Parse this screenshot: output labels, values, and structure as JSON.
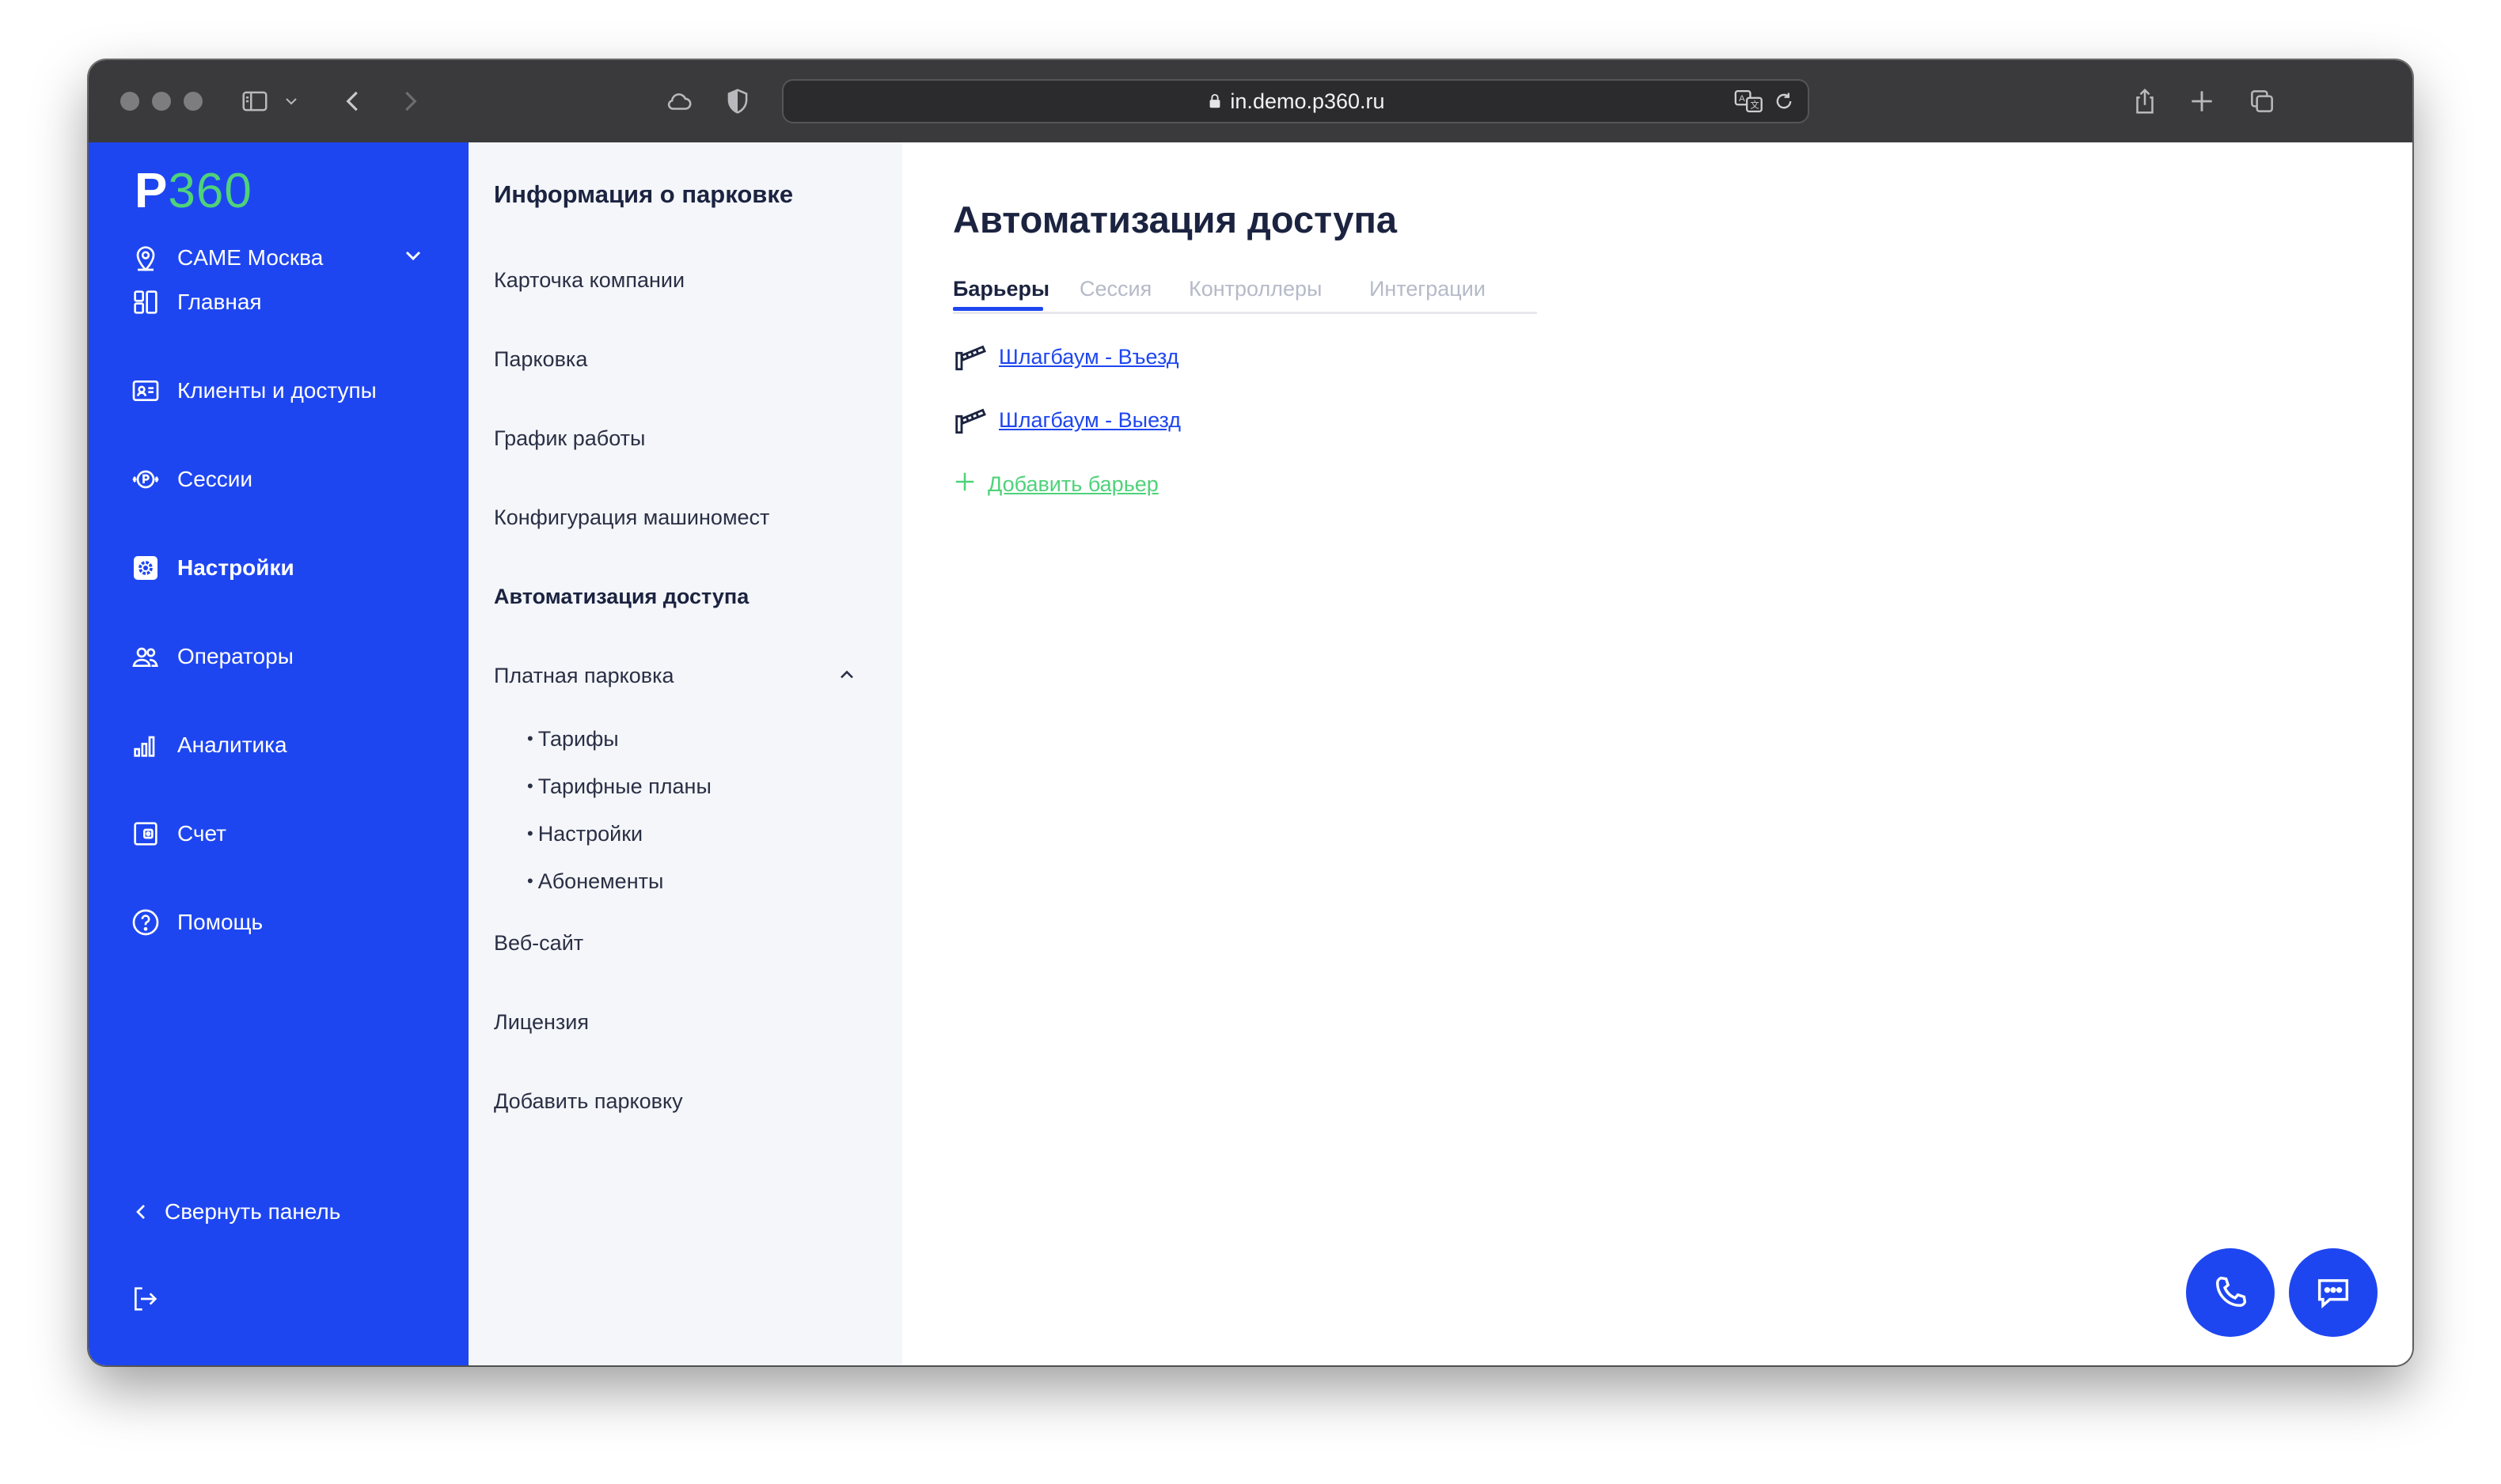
{
  "browser": {
    "url": "in.demo.p360.ru",
    "icons": [
      "sidebar-icon",
      "chevron-down-icon",
      "back-icon",
      "forward-icon",
      "cloud-icon",
      "shield-icon",
      "lock-icon",
      "translate-icon",
      "reload-icon",
      "share-icon",
      "new-tab-icon",
      "tabs-overview-icon"
    ]
  },
  "sidebar": {
    "logo_p": "P",
    "logo_num": "360",
    "location": "CAME Москва",
    "items": [
      {
        "label": "Главная",
        "icon": "dashboard-icon"
      },
      {
        "label": "Клиенты и доступы",
        "icon": "id-card-icon"
      },
      {
        "label": "Сессии",
        "icon": "parking-session-icon"
      },
      {
        "label": "Настройки",
        "icon": "gear-icon"
      },
      {
        "label": "Операторы",
        "icon": "users-icon"
      },
      {
        "label": "Аналитика",
        "icon": "bar-chart-icon"
      },
      {
        "label": "Счет",
        "icon": "wallet-icon"
      },
      {
        "label": "Помощь",
        "icon": "help-icon"
      }
    ],
    "collapse_label": "Свернуть панель"
  },
  "submenu": {
    "title": "Информация о парковке",
    "items": [
      "Карточка компании",
      "Парковка",
      "График работы",
      "Конфигурация машиномест",
      "Автоматизация доступа",
      "Платная парковка"
    ],
    "sub_items": [
      "Тарифы",
      "Тарифные планы",
      "Настройки",
      "Абонементы"
    ],
    "items_after": [
      "Веб-сайт",
      "Лицензия",
      "Добавить парковку"
    ]
  },
  "main": {
    "title": "Автоматизация доступа",
    "tabs": [
      "Барьеры",
      "Сессия",
      "Контроллеры",
      "Интеграции"
    ],
    "active_tab": "Барьеры",
    "barriers": [
      "Шлагбаум - Въезд",
      "Шлагбаум - Выезд"
    ],
    "add_barrier_label": "Добавить барьер"
  },
  "colors": {
    "brand_blue": "#1e46f0",
    "accent_green": "#4fd27a",
    "text_dark": "#1b2340"
  }
}
